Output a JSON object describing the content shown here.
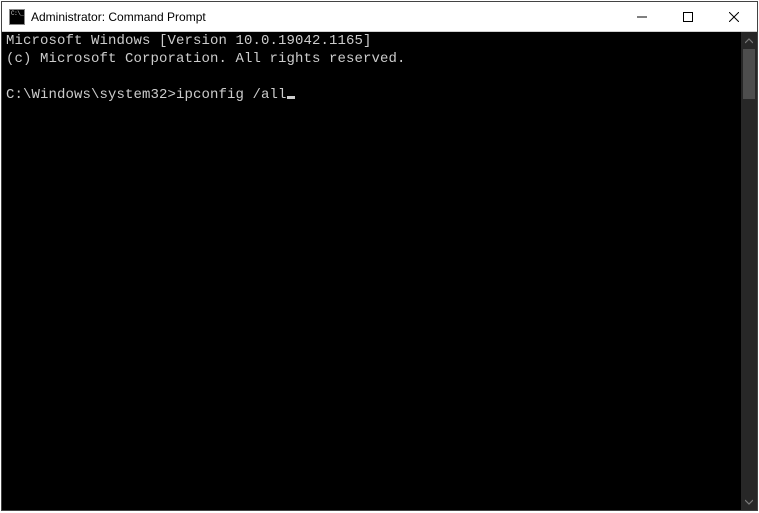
{
  "window": {
    "title": "Administrator: Command Prompt"
  },
  "terminal": {
    "line1": "Microsoft Windows [Version 10.0.19042.1165]",
    "line2": "(c) Microsoft Corporation. All rights reserved.",
    "blank": "",
    "prompt_path": "C:\\Windows\\system32>",
    "command": "ipconfig /all"
  }
}
